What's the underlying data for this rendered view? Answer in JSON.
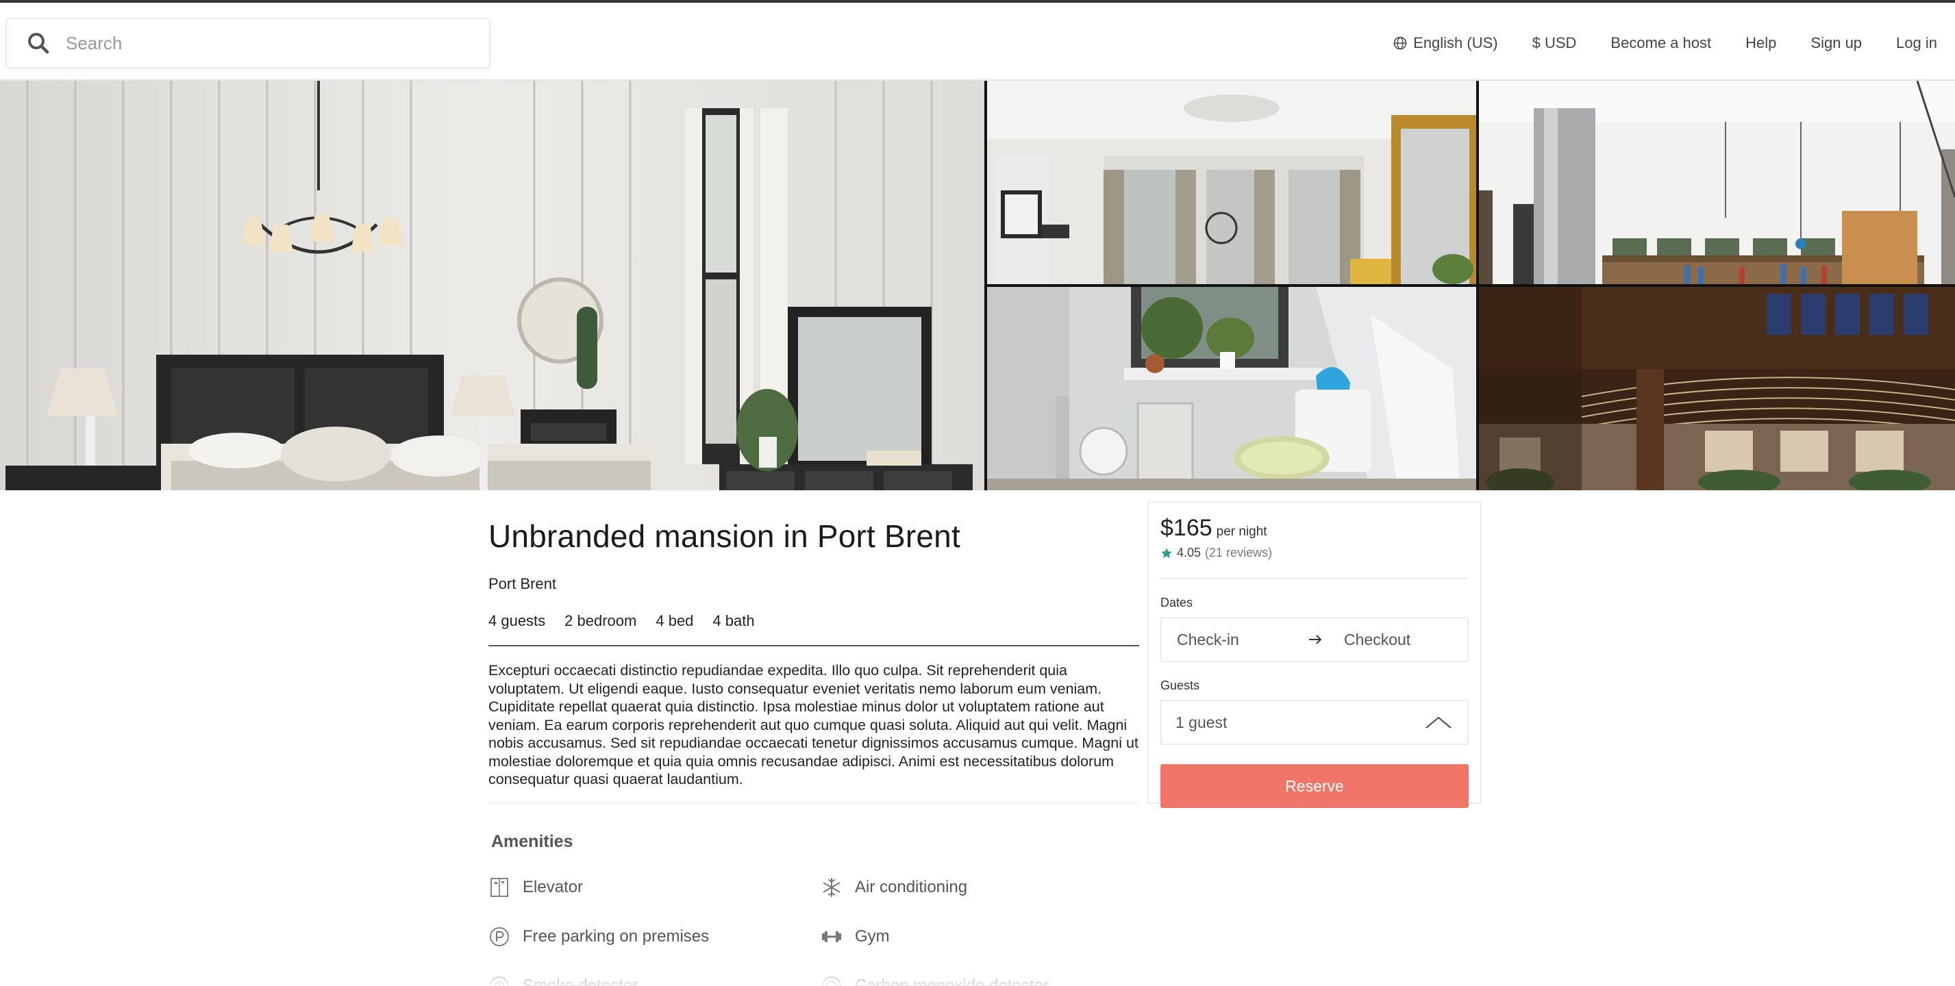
{
  "header": {
    "search_placeholder": "Search",
    "nav": {
      "language": "English (US)",
      "currency": "$ USD",
      "become_host": "Become a host",
      "help": "Help",
      "signup": "Sign up",
      "login": "Log in"
    }
  },
  "listing": {
    "title": "Unbranded mansion in Port Brent",
    "location": "Port Brent",
    "facts": [
      "4 guests",
      "2 bedroom",
      "4 bed",
      "4 bath"
    ],
    "description": "Excepturi occaecati distinctio repudiandae expedita. Illo quo culpa. Sit reprehenderit quia voluptatem. Ut eligendi eaque. Iusto consequatur eveniet veritatis nemo laborum eum veniam. Cupiditate repellat quaerat quia distinctio. Ipsa molestiae minus dolor ut voluptatem ratione aut veniam. Ea earum corporis reprehenderit aut quo cumque quasi soluta. Aliquid aut qui velit. Magni nobis accusamus. Sed sit repudiandae occaecati tenetur dignissimos accusamus cumque. Magni ut molestiae doloremque et quia quia omnis recusandae adipisci. Animi est necessitatibus dolorum consequatur quasi quaerat laudantium.",
    "amenities_title": "Amenities",
    "amenities": [
      {
        "label": "Elevator",
        "icon": "elevator-icon",
        "available": true
      },
      {
        "label": "Air conditioning",
        "icon": "snowflake-icon",
        "available": true
      },
      {
        "label": "Free parking on premises",
        "icon": "parking-icon",
        "available": true
      },
      {
        "label": "Gym",
        "icon": "dumbbell-icon",
        "available": true
      },
      {
        "label": "Smoke detector",
        "icon": "smoke-detector-icon",
        "available": false
      },
      {
        "label": "Carbon monoxide detector",
        "icon": "co-detector-icon",
        "available": false
      }
    ]
  },
  "booking": {
    "price": "$165",
    "per_night": "per night",
    "rating": "4.05",
    "reviews": "(21 reviews)",
    "dates_label": "Dates",
    "checkin_placeholder": "Check-in",
    "checkout_placeholder": "Checkout",
    "guests_label": "Guests",
    "guests_value": "1 guest",
    "reserve_label": "Reserve"
  },
  "colors": {
    "accent": "#ef7568",
    "star": "#2a9d8f",
    "text": "#222222",
    "muted": "#555555"
  },
  "photos": [
    {
      "name": "photo-bedroom",
      "subject": "bedroom with chandelier and dresser"
    },
    {
      "name": "photo-living-room",
      "subject": "white room with tall windows and gold mirror"
    },
    {
      "name": "photo-kitchen",
      "subject": "kitchen with pendant lights and shelves"
    },
    {
      "name": "photo-bathroom",
      "subject": "bathroom with plants on windowsill"
    },
    {
      "name": "photo-atrium",
      "subject": "wooden atrium interior"
    }
  ]
}
